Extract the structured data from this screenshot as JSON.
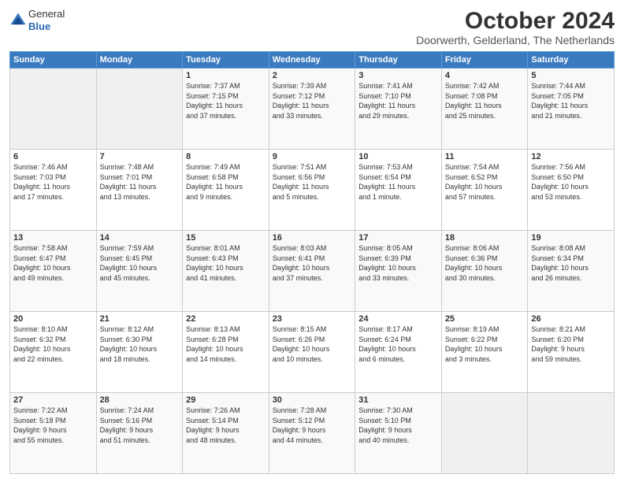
{
  "header": {
    "logo": {
      "general": "General",
      "blue": "Blue"
    },
    "title": "October 2024",
    "subtitle": "Doorwerth, Gelderland, The Netherlands"
  },
  "days_of_week": [
    "Sunday",
    "Monday",
    "Tuesday",
    "Wednesday",
    "Thursday",
    "Friday",
    "Saturday"
  ],
  "weeks": [
    [
      {
        "day": "",
        "info": ""
      },
      {
        "day": "",
        "info": ""
      },
      {
        "day": "1",
        "info": "Sunrise: 7:37 AM\nSunset: 7:15 PM\nDaylight: 11 hours\nand 37 minutes."
      },
      {
        "day": "2",
        "info": "Sunrise: 7:39 AM\nSunset: 7:12 PM\nDaylight: 11 hours\nand 33 minutes."
      },
      {
        "day": "3",
        "info": "Sunrise: 7:41 AM\nSunset: 7:10 PM\nDaylight: 11 hours\nand 29 minutes."
      },
      {
        "day": "4",
        "info": "Sunrise: 7:42 AM\nSunset: 7:08 PM\nDaylight: 11 hours\nand 25 minutes."
      },
      {
        "day": "5",
        "info": "Sunrise: 7:44 AM\nSunset: 7:05 PM\nDaylight: 11 hours\nand 21 minutes."
      }
    ],
    [
      {
        "day": "6",
        "info": "Sunrise: 7:46 AM\nSunset: 7:03 PM\nDaylight: 11 hours\nand 17 minutes."
      },
      {
        "day": "7",
        "info": "Sunrise: 7:48 AM\nSunset: 7:01 PM\nDaylight: 11 hours\nand 13 minutes."
      },
      {
        "day": "8",
        "info": "Sunrise: 7:49 AM\nSunset: 6:58 PM\nDaylight: 11 hours\nand 9 minutes."
      },
      {
        "day": "9",
        "info": "Sunrise: 7:51 AM\nSunset: 6:56 PM\nDaylight: 11 hours\nand 5 minutes."
      },
      {
        "day": "10",
        "info": "Sunrise: 7:53 AM\nSunset: 6:54 PM\nDaylight: 11 hours\nand 1 minute."
      },
      {
        "day": "11",
        "info": "Sunrise: 7:54 AM\nSunset: 6:52 PM\nDaylight: 10 hours\nand 57 minutes."
      },
      {
        "day": "12",
        "info": "Sunrise: 7:56 AM\nSunset: 6:50 PM\nDaylight: 10 hours\nand 53 minutes."
      }
    ],
    [
      {
        "day": "13",
        "info": "Sunrise: 7:58 AM\nSunset: 6:47 PM\nDaylight: 10 hours\nand 49 minutes."
      },
      {
        "day": "14",
        "info": "Sunrise: 7:59 AM\nSunset: 6:45 PM\nDaylight: 10 hours\nand 45 minutes."
      },
      {
        "day": "15",
        "info": "Sunrise: 8:01 AM\nSunset: 6:43 PM\nDaylight: 10 hours\nand 41 minutes."
      },
      {
        "day": "16",
        "info": "Sunrise: 8:03 AM\nSunset: 6:41 PM\nDaylight: 10 hours\nand 37 minutes."
      },
      {
        "day": "17",
        "info": "Sunrise: 8:05 AM\nSunset: 6:39 PM\nDaylight: 10 hours\nand 33 minutes."
      },
      {
        "day": "18",
        "info": "Sunrise: 8:06 AM\nSunset: 6:36 PM\nDaylight: 10 hours\nand 30 minutes."
      },
      {
        "day": "19",
        "info": "Sunrise: 8:08 AM\nSunset: 6:34 PM\nDaylight: 10 hours\nand 26 minutes."
      }
    ],
    [
      {
        "day": "20",
        "info": "Sunrise: 8:10 AM\nSunset: 6:32 PM\nDaylight: 10 hours\nand 22 minutes."
      },
      {
        "day": "21",
        "info": "Sunrise: 8:12 AM\nSunset: 6:30 PM\nDaylight: 10 hours\nand 18 minutes."
      },
      {
        "day": "22",
        "info": "Sunrise: 8:13 AM\nSunset: 6:28 PM\nDaylight: 10 hours\nand 14 minutes."
      },
      {
        "day": "23",
        "info": "Sunrise: 8:15 AM\nSunset: 6:26 PM\nDaylight: 10 hours\nand 10 minutes."
      },
      {
        "day": "24",
        "info": "Sunrise: 8:17 AM\nSunset: 6:24 PM\nDaylight: 10 hours\nand 6 minutes."
      },
      {
        "day": "25",
        "info": "Sunrise: 8:19 AM\nSunset: 6:22 PM\nDaylight: 10 hours\nand 3 minutes."
      },
      {
        "day": "26",
        "info": "Sunrise: 8:21 AM\nSunset: 6:20 PM\nDaylight: 9 hours\nand 59 minutes."
      }
    ],
    [
      {
        "day": "27",
        "info": "Sunrise: 7:22 AM\nSunset: 5:18 PM\nDaylight: 9 hours\nand 55 minutes."
      },
      {
        "day": "28",
        "info": "Sunrise: 7:24 AM\nSunset: 5:16 PM\nDaylight: 9 hours\nand 51 minutes."
      },
      {
        "day": "29",
        "info": "Sunrise: 7:26 AM\nSunset: 5:14 PM\nDaylight: 9 hours\nand 48 minutes."
      },
      {
        "day": "30",
        "info": "Sunrise: 7:28 AM\nSunset: 5:12 PM\nDaylight: 9 hours\nand 44 minutes."
      },
      {
        "day": "31",
        "info": "Sunrise: 7:30 AM\nSunset: 5:10 PM\nDaylight: 9 hours\nand 40 minutes."
      },
      {
        "day": "",
        "info": ""
      },
      {
        "day": "",
        "info": ""
      }
    ]
  ]
}
